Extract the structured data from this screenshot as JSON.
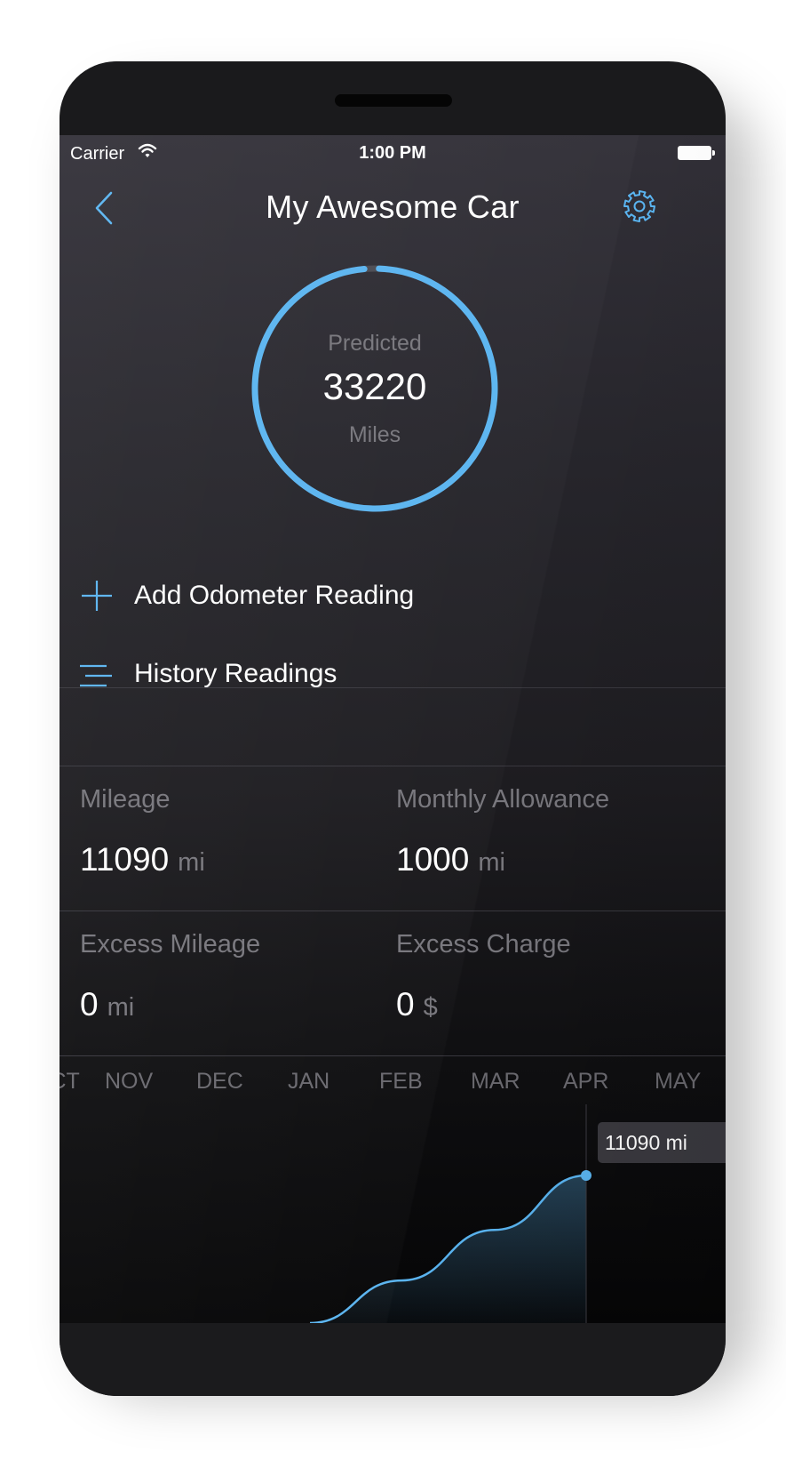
{
  "status_bar": {
    "carrier": "Carrier",
    "time": "1:00 PM"
  },
  "nav": {
    "title": "My Awesome Car",
    "back_icon": "chevron-left-icon",
    "settings_icon": "gear-icon"
  },
  "prediction": {
    "label": "Predicted",
    "value": "33220",
    "unit": "Miles",
    "progress_fraction": 0.98
  },
  "actions": {
    "add_reading": "Add Odometer Reading",
    "history": "History Readings"
  },
  "stats": [
    {
      "label": "Mileage",
      "value": "11090",
      "unit": "mi"
    },
    {
      "label": "Monthly Allowance",
      "value": "1000",
      "unit": "mi"
    },
    {
      "label": "Excess Mileage",
      "value": "0",
      "unit": "mi"
    },
    {
      "label": "Excess Charge",
      "value": "0",
      "unit": "$"
    }
  ],
  "timeline": {
    "months": [
      "OCT",
      "NOV",
      "DEC",
      "JAN",
      "FEB",
      "MAR",
      "APR",
      "MAY"
    ],
    "tooltip": "11090 mi"
  },
  "chart_data": {
    "type": "area",
    "x": [
      "JAN",
      "FEB",
      "MAR",
      "APR"
    ],
    "y": [
      0,
      3200,
      7000,
      11090
    ],
    "title": "",
    "xlabel": "",
    "ylabel": ""
  },
  "colors": {
    "accent": "#5ab4f0",
    "track": "#4a4950",
    "muted_text": "#77767c"
  }
}
